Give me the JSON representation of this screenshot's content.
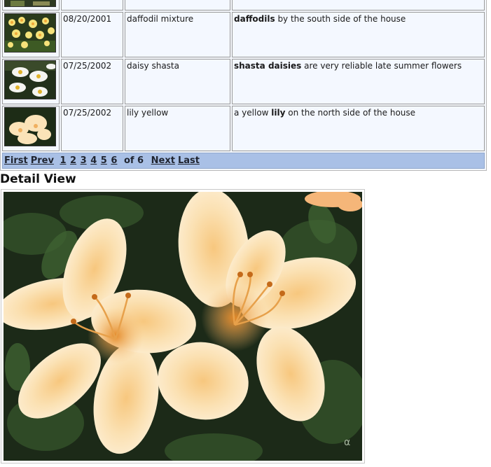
{
  "rows": [
    {
      "date": "",
      "name": "",
      "desc_pre": "",
      "desc_kw": "",
      "desc_post": "",
      "thumb": "partial-icon"
    },
    {
      "date": "08/20/2001",
      "name": "daffodil mixture",
      "desc_pre": "",
      "desc_kw": "daffodils",
      "desc_post": " by the south side of the house",
      "thumb": "daffodil-thumbnail"
    },
    {
      "date": "07/25/2002",
      "name": "daisy shasta",
      "desc_pre": "",
      "desc_kw": "shasta daisies",
      "desc_post": " are very reliable late summer flowers",
      "thumb": "daisy-thumbnail"
    },
    {
      "date": "07/25/2002",
      "name": "lily yellow",
      "desc_pre": "a yellow ",
      "desc_kw": "lily",
      "desc_post": " on the north side of the house",
      "thumb": "lily-thumbnail"
    }
  ],
  "pager": {
    "first": "First",
    "prev": "Prev",
    "pages": [
      "1",
      "2",
      "3",
      "4",
      "5",
      "6"
    ],
    "of_text": "of 6",
    "next": "Next",
    "last": "Last"
  },
  "detail": {
    "title": "Detail View",
    "watermark": "α",
    "image": "yellow-lily-photo"
  },
  "colors": {
    "pager_bg": "#a9c0e6",
    "row_bg": "#f4f8ff",
    "lily_petal": "#fbe3b8",
    "foliage": "#1f3a1c"
  }
}
